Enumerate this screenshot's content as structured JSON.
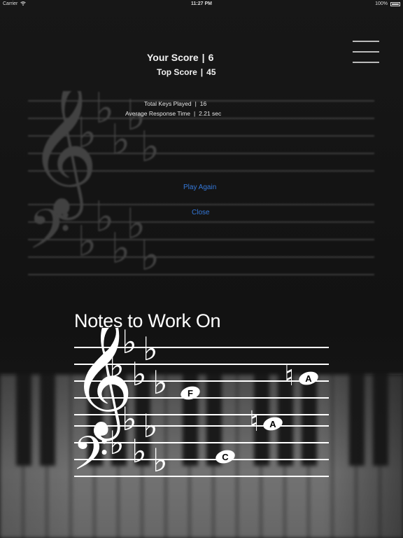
{
  "status_bar": {
    "carrier": "Carrier",
    "time": "11:27 PM",
    "battery": "100%"
  },
  "menu": {
    "icon": "hamburger-menu-icon"
  },
  "results": {
    "your_score_label": "Your Score",
    "your_score_value": "6",
    "top_score_label": "Top Score",
    "top_score_value": "45",
    "keys_played_label": "Total Keys Played",
    "keys_played_value": "16",
    "response_time_label": "Average Response Time",
    "response_time_value": "2.21 sec",
    "separator": "|"
  },
  "actions": {
    "play_again": "Play Again",
    "close": "Close"
  },
  "notes_section": {
    "title": "Notes to Work On",
    "key_signature": "D-flat major (5 flats)",
    "notes": [
      {
        "label": "F",
        "clef": "treble",
        "accidental": "none"
      },
      {
        "label": "A",
        "clef": "treble",
        "accidental": "natural"
      },
      {
        "label": "A",
        "clef": "bass",
        "accidental": "natural"
      },
      {
        "label": "C",
        "clef": "bass",
        "accidental": "none"
      }
    ]
  },
  "colors": {
    "background": "#141414",
    "link": "#3478d9",
    "text": "#ffffff"
  }
}
